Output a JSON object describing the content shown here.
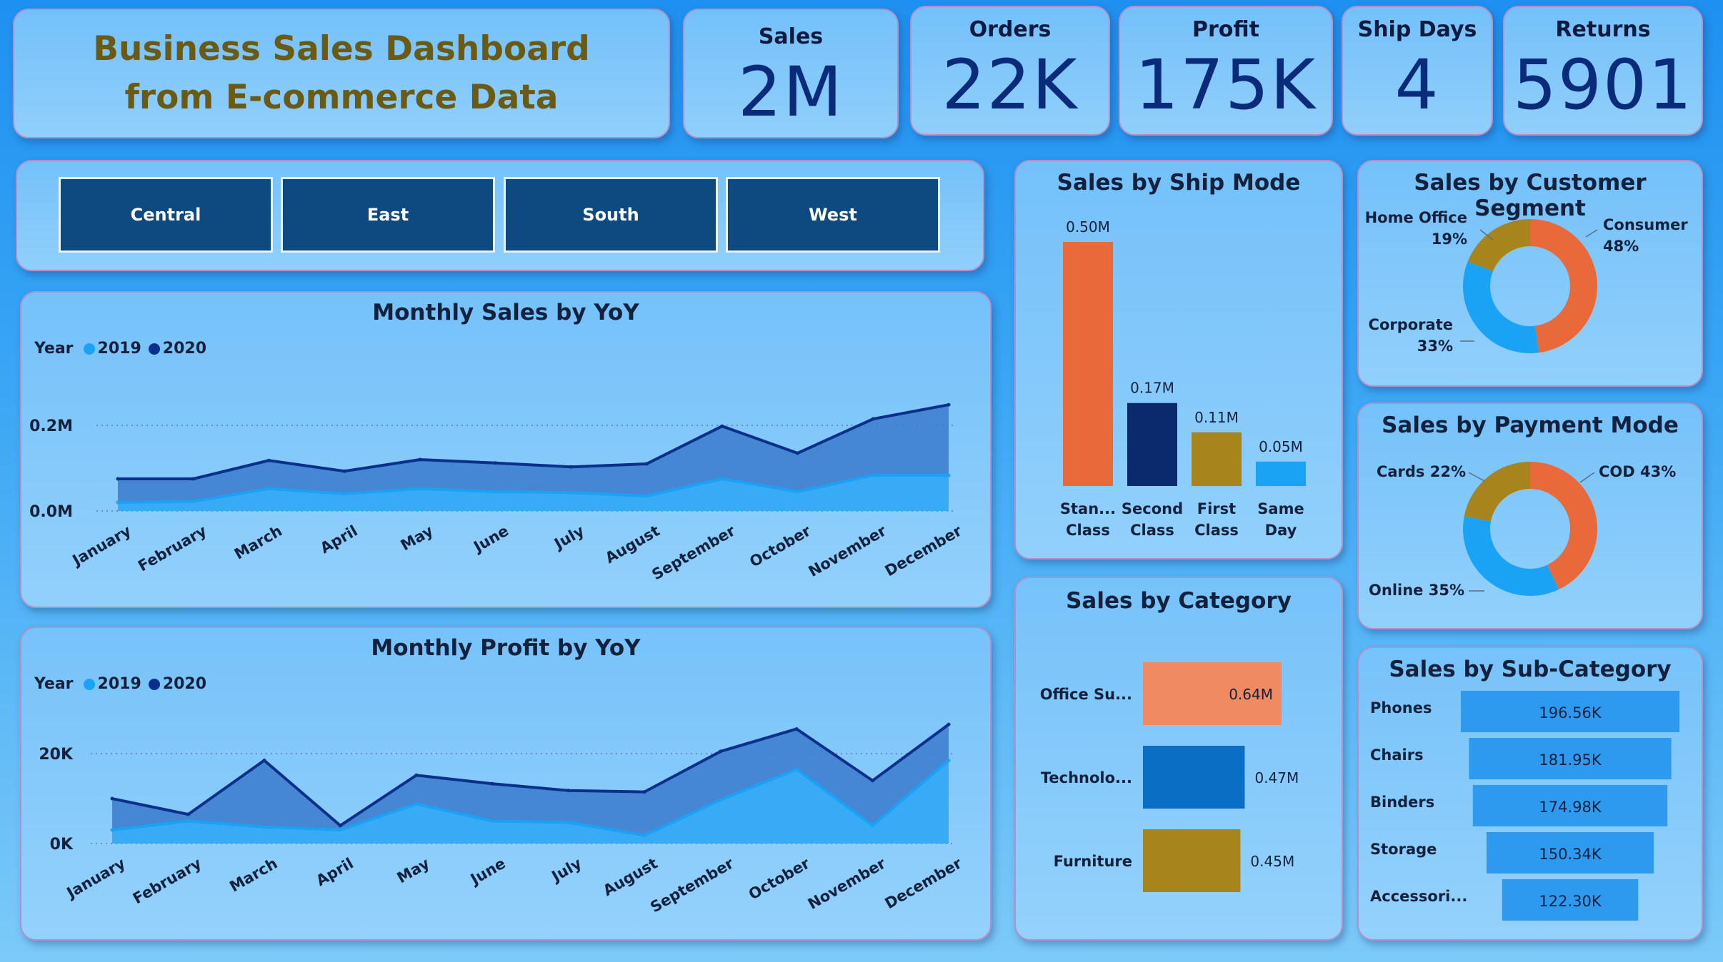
{
  "header": {
    "title": "Business Sales Dashboard from E-commerce Data"
  },
  "kpis": [
    {
      "label": "Sales",
      "value": "2M"
    },
    {
      "label": "Orders",
      "value": "22K"
    },
    {
      "label": "Profit",
      "value": "175K"
    },
    {
      "label": "Ship Days",
      "value": "4"
    },
    {
      "label": "Returns",
      "value": "5901"
    }
  ],
  "regions": [
    "Central",
    "East",
    "South",
    "West"
  ],
  "colors": {
    "series2019": "#1aa3f5",
    "series2020": "#0b2f8c",
    "area2020": "#3f7fcf",
    "orange": "#e8693a",
    "navy": "#0b2a6e",
    "gold": "#a8851c",
    "lightblue": "#1aa3f5",
    "salmon": "#f08a63",
    "blue": "#0a6ec4"
  },
  "chart_data": [
    {
      "id": "monthly_sales",
      "type": "area",
      "title": "Monthly Sales by YoY",
      "legend_title": "Year",
      "categories": [
        "January",
        "February",
        "March",
        "April",
        "May",
        "June",
        "July",
        "August",
        "September",
        "October",
        "November",
        "December"
      ],
      "series": [
        {
          "name": "2019",
          "values": [
            0.02,
            0.022,
            0.052,
            0.04,
            0.052,
            0.045,
            0.043,
            0.035,
            0.075,
            0.045,
            0.083,
            0.083
          ]
        },
        {
          "name": "2020",
          "values": [
            0.075,
            0.075,
            0.118,
            0.093,
            0.12,
            0.112,
            0.103,
            0.11,
            0.198,
            0.135,
            0.215,
            0.248
          ]
        }
      ],
      "yticks": [
        "0.0M",
        "0.2M"
      ],
      "ylim": [
        0,
        0.26
      ]
    },
    {
      "id": "monthly_profit",
      "type": "area",
      "title": "Monthly Profit by YoY",
      "legend_title": "Year",
      "categories": [
        "January",
        "February",
        "March",
        "April",
        "May",
        "June",
        "July",
        "August",
        "September",
        "October",
        "November",
        "December"
      ],
      "series": [
        {
          "name": "2019",
          "values": [
            3000,
            5000,
            3700,
            3000,
            8800,
            5000,
            4700,
            1800,
            9700,
            16500,
            4000,
            18500
          ]
        },
        {
          "name": "2020",
          "values": [
            10000,
            6500,
            18500,
            4000,
            15200,
            13300,
            11800,
            11500,
            20500,
            25500,
            14000,
            26500
          ]
        }
      ],
      "yticks": [
        "0K",
        "20K"
      ],
      "ylim": [
        0,
        27000
      ]
    },
    {
      "id": "ship_mode",
      "type": "bar",
      "title": "Sales by Ship Mode",
      "categories": [
        "Stan... Class",
        "Second Class",
        "First Class",
        "Same Day"
      ],
      "values": [
        0.5,
        0.17,
        0.11,
        0.05
      ],
      "labels": [
        "0.50M",
        "0.17M",
        "0.11M",
        "0.05M"
      ]
    },
    {
      "id": "customer_segment",
      "type": "pie",
      "title": "Sales by Customer Segment",
      "categories": [
        "Consumer",
        "Corporate",
        "Home Office"
      ],
      "values": [
        48,
        33,
        19
      ],
      "labels": [
        "Consumer 48%",
        "Corporate 33%",
        "Home Office 19%"
      ]
    },
    {
      "id": "payment_mode",
      "type": "pie",
      "title": "Sales by Payment Mode",
      "categories": [
        "COD",
        "Online",
        "Cards"
      ],
      "values": [
        43,
        35,
        22
      ],
      "labels": [
        "COD 43%",
        "Online 35%",
        "Cards 22%"
      ]
    },
    {
      "id": "category",
      "type": "bar",
      "title": "Sales by Category",
      "categories": [
        "Office Su...",
        "Technolo...",
        "Furniture"
      ],
      "values": [
        0.64,
        0.47,
        0.45
      ],
      "labels": [
        "0.64M",
        "0.47M",
        "0.45M"
      ]
    },
    {
      "id": "sub_category",
      "type": "bar",
      "title": "Sales by Sub-Category",
      "categories": [
        "Phones",
        "Chairs",
        "Binders",
        "Storage",
        "Accessori..."
      ],
      "values": [
        196.56,
        181.95,
        174.98,
        150.34,
        122.3
      ],
      "labels": [
        "196.56K",
        "181.95K",
        "174.98K",
        "150.34K",
        "122.30K"
      ]
    }
  ]
}
